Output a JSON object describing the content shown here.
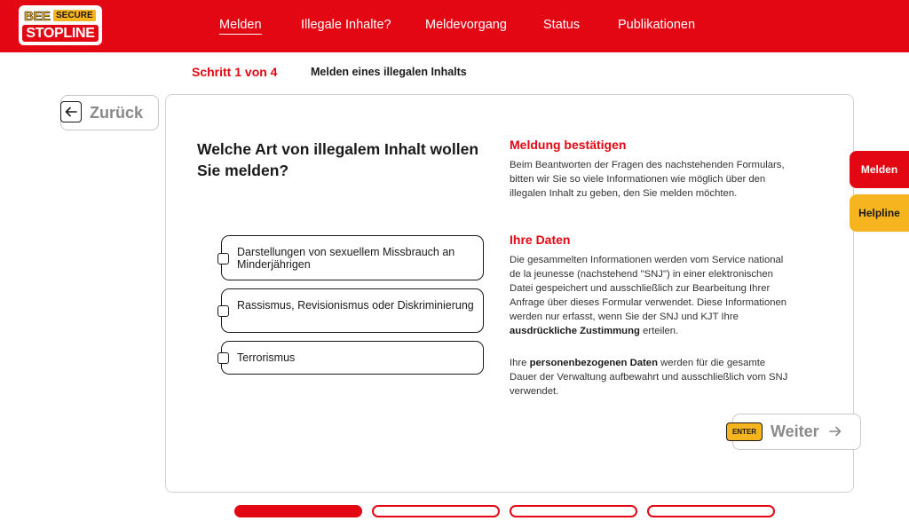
{
  "brand": {
    "logo_top_left": "BEE",
    "logo_top_right": "SECURE",
    "logo_bottom": "STOPLINE"
  },
  "nav": {
    "items": [
      {
        "label": "Melden",
        "active": true
      },
      {
        "label": "Illegale Inhalte?",
        "active": false
      },
      {
        "label": "Meldevorgang",
        "active": false
      },
      {
        "label": "Status",
        "active": false
      },
      {
        "label": "Publikationen",
        "active": false
      }
    ]
  },
  "step": {
    "indicator": "Schritt 1 von 4",
    "title": "Melden eines illegalen Inhalts"
  },
  "back_button": {
    "label": "Zurück",
    "icon": "arrow-left-icon"
  },
  "form": {
    "question": "Welche Art von illegalem Inhalt wollen Sie melden?",
    "options": [
      {
        "label": "Darstellungen von sexuellem Missbrauch an Minderjährigen",
        "checked": false
      },
      {
        "label": "Rassismus, Revisionismus oder Diskriminierung",
        "checked": false
      },
      {
        "label": "Terrorismus",
        "checked": false
      }
    ]
  },
  "info": {
    "confirm_heading": "Meldung bestätigen",
    "confirm_text": "Beim Beantworten der Fragen des nachstehenden Formulars, bitten wir Sie so viele Informationen wie möglich über den illegalen Inhalt zu geben, den Sie melden möchten.",
    "data_heading": "Ihre Daten",
    "data_text_1_start": "Die gesammelten Informationen werden vom Service national de la jeunesse (nachstehend \"SNJ\") in einer elektronischen Datei gespeichert und ausschließlich zur Bearbeitung Ihrer Anfrage über dieses Formular verwendet. Diese Informationen werden nur erfasst, wenn Sie der SNJ und KJT Ihre ",
    "data_text_1_bold": "ausdrückliche Zustimmung",
    "data_text_1_end": " erteilen.",
    "data_text_2_start": "Ihre ",
    "data_text_2_bold": "personenbezogenen Daten",
    "data_text_2_end": " werden für die gesamte Dauer der Verwaltung aufbewahrt und ausschließlich vom SNJ verwendet."
  },
  "next_button": {
    "badge": "ENTER",
    "label": "Weiter",
    "icon": "arrow-right-icon"
  },
  "side_tabs": {
    "report": "Melden",
    "help": "Helpline"
  },
  "progress": {
    "total_steps": 4,
    "current_step": 1
  },
  "colors": {
    "primary_red": "#e30613",
    "accent_yellow": "#f6b51f"
  }
}
